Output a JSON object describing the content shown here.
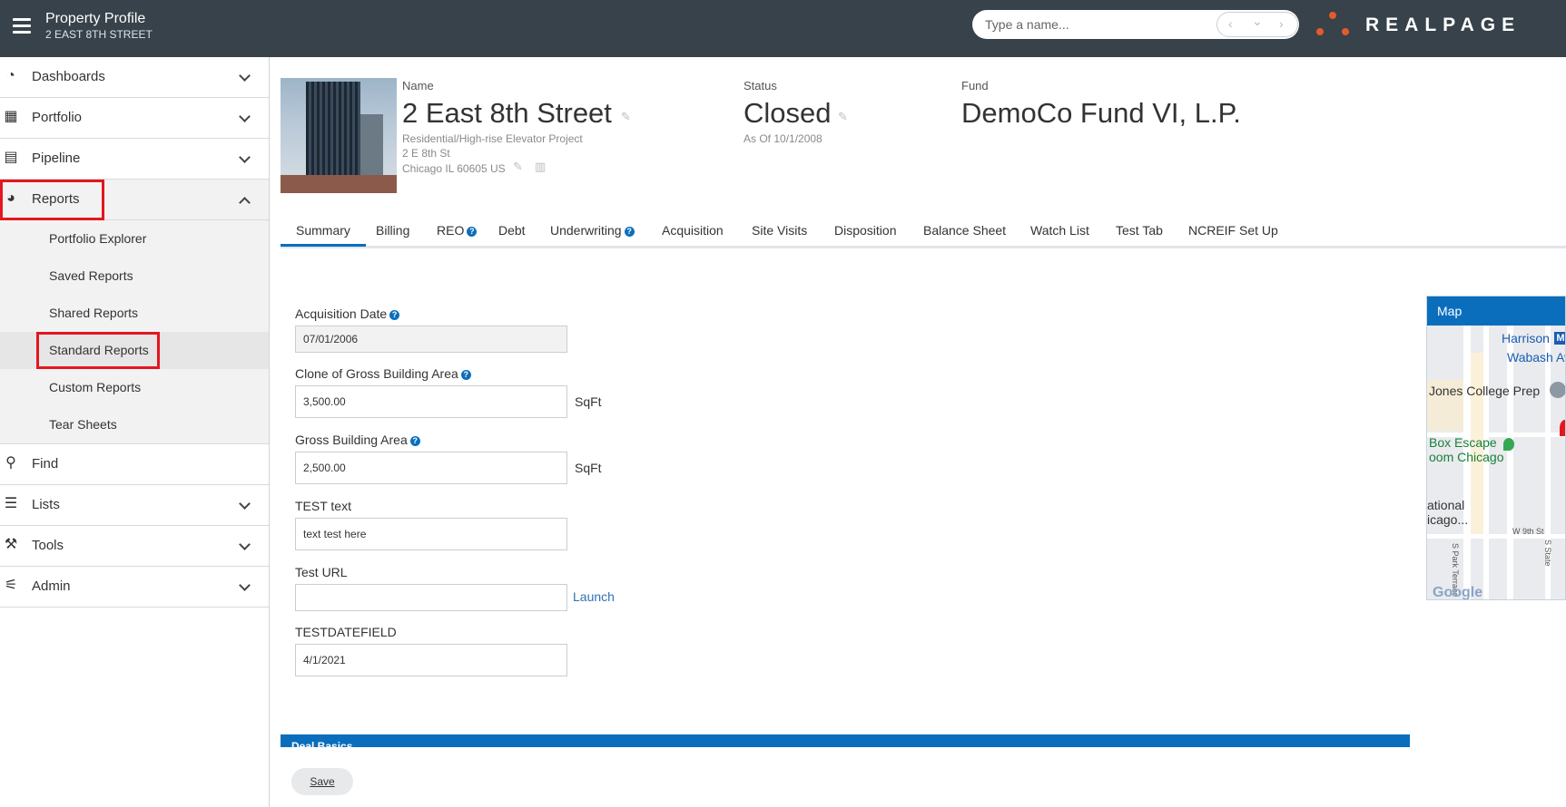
{
  "header": {
    "title": "Property Profile",
    "subtitle": "2 EAST 8TH STREET",
    "search_placeholder": "Type a name...",
    "prev_glyph": "‹",
    "down_glyph": "⌄",
    "next_glyph": "›",
    "brand": "REALPAGE",
    "brand_color": "#e35b2c"
  },
  "sidebar": {
    "items": [
      {
        "label": "Dashboards",
        "icon": "dashboard-icon"
      },
      {
        "label": "Portfolio",
        "icon": "building-icon"
      },
      {
        "label": "Pipeline",
        "icon": "newspaper-icon"
      },
      {
        "label": "Reports",
        "icon": "pie-chart-icon"
      },
      {
        "label": "Find",
        "icon": "search-icon"
      },
      {
        "label": "Lists",
        "icon": "list-icon"
      },
      {
        "label": "Tools",
        "icon": "hammer-icon"
      },
      {
        "label": "Admin",
        "icon": "sliders-icon"
      }
    ],
    "report_subitems": [
      "Portfolio Explorer",
      "Saved Reports",
      "Shared Reports",
      "Standard Reports",
      "Custom Reports",
      "Tear Sheets"
    ]
  },
  "property": {
    "name_label": "Name",
    "name": "2 East 8th Street",
    "type": "Residential/High-rise Elevator Project",
    "address1": "2 E 8th St",
    "address2": "Chicago IL 60605 US",
    "status_label": "Status",
    "status": "Closed",
    "status_as_of": "As Of 10/1/2008",
    "fund_label": "Fund",
    "fund": "DemoCo Fund VI, L.P."
  },
  "tabs": [
    "Summary",
    "Billing",
    "REO",
    "Debt",
    "Underwriting",
    "Acquisition",
    "Site Visits",
    "Disposition",
    "Balance Sheet",
    "Watch List",
    "Test Tab",
    "NCREIF Set Up"
  ],
  "form": {
    "acquisition_date_label": "Acquisition Date",
    "acquisition_date": "07/01/2006",
    "clone_gba_label": "Clone of Gross Building Area",
    "clone_gba": "3,500.00",
    "gba_label": "Gross Building Area",
    "gba": "2,500.00",
    "unit": "SqFt",
    "test_text_label": "TEST text",
    "test_text": "text test here",
    "test_url_label": "Test URL",
    "test_url": "",
    "launch": "Launch",
    "testdate_label": "TESTDATEFIELD",
    "testdate": "4/1/2021"
  },
  "map": {
    "title": "Map",
    "labels": [
      "Harrison",
      "Wabash Av",
      "Jones College Prep",
      "Box Escape",
      "oom Chicago",
      "ational",
      "icago...",
      "S Park Terrace",
      "W 9th St",
      "S State"
    ],
    "metro": "M"
  },
  "section": "Deal Basics",
  "save_label": "Save",
  "accent_color": "#0a6ebd"
}
